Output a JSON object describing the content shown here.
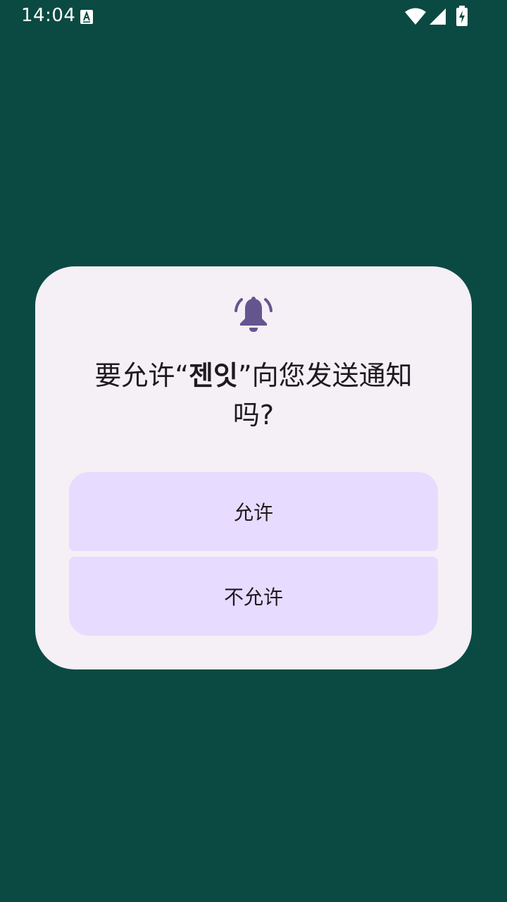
{
  "status_bar": {
    "time": "14:04",
    "icons": [
      "keyboard-a-icon",
      "wifi-icon",
      "signal-icon",
      "battery-charging-icon"
    ]
  },
  "dialog": {
    "icon": "notification-bell-icon",
    "title_prefix": "要允许“",
    "app_name": "젠잇",
    "title_suffix": "”向您发送通知吗?",
    "allow_label": "允许",
    "deny_label": "不允许"
  },
  "colors": {
    "background": "#0a4a42",
    "dialog": "#f5eff6",
    "button": "#e7dbff",
    "icon": "#65558f",
    "text": "#1d1b20"
  }
}
